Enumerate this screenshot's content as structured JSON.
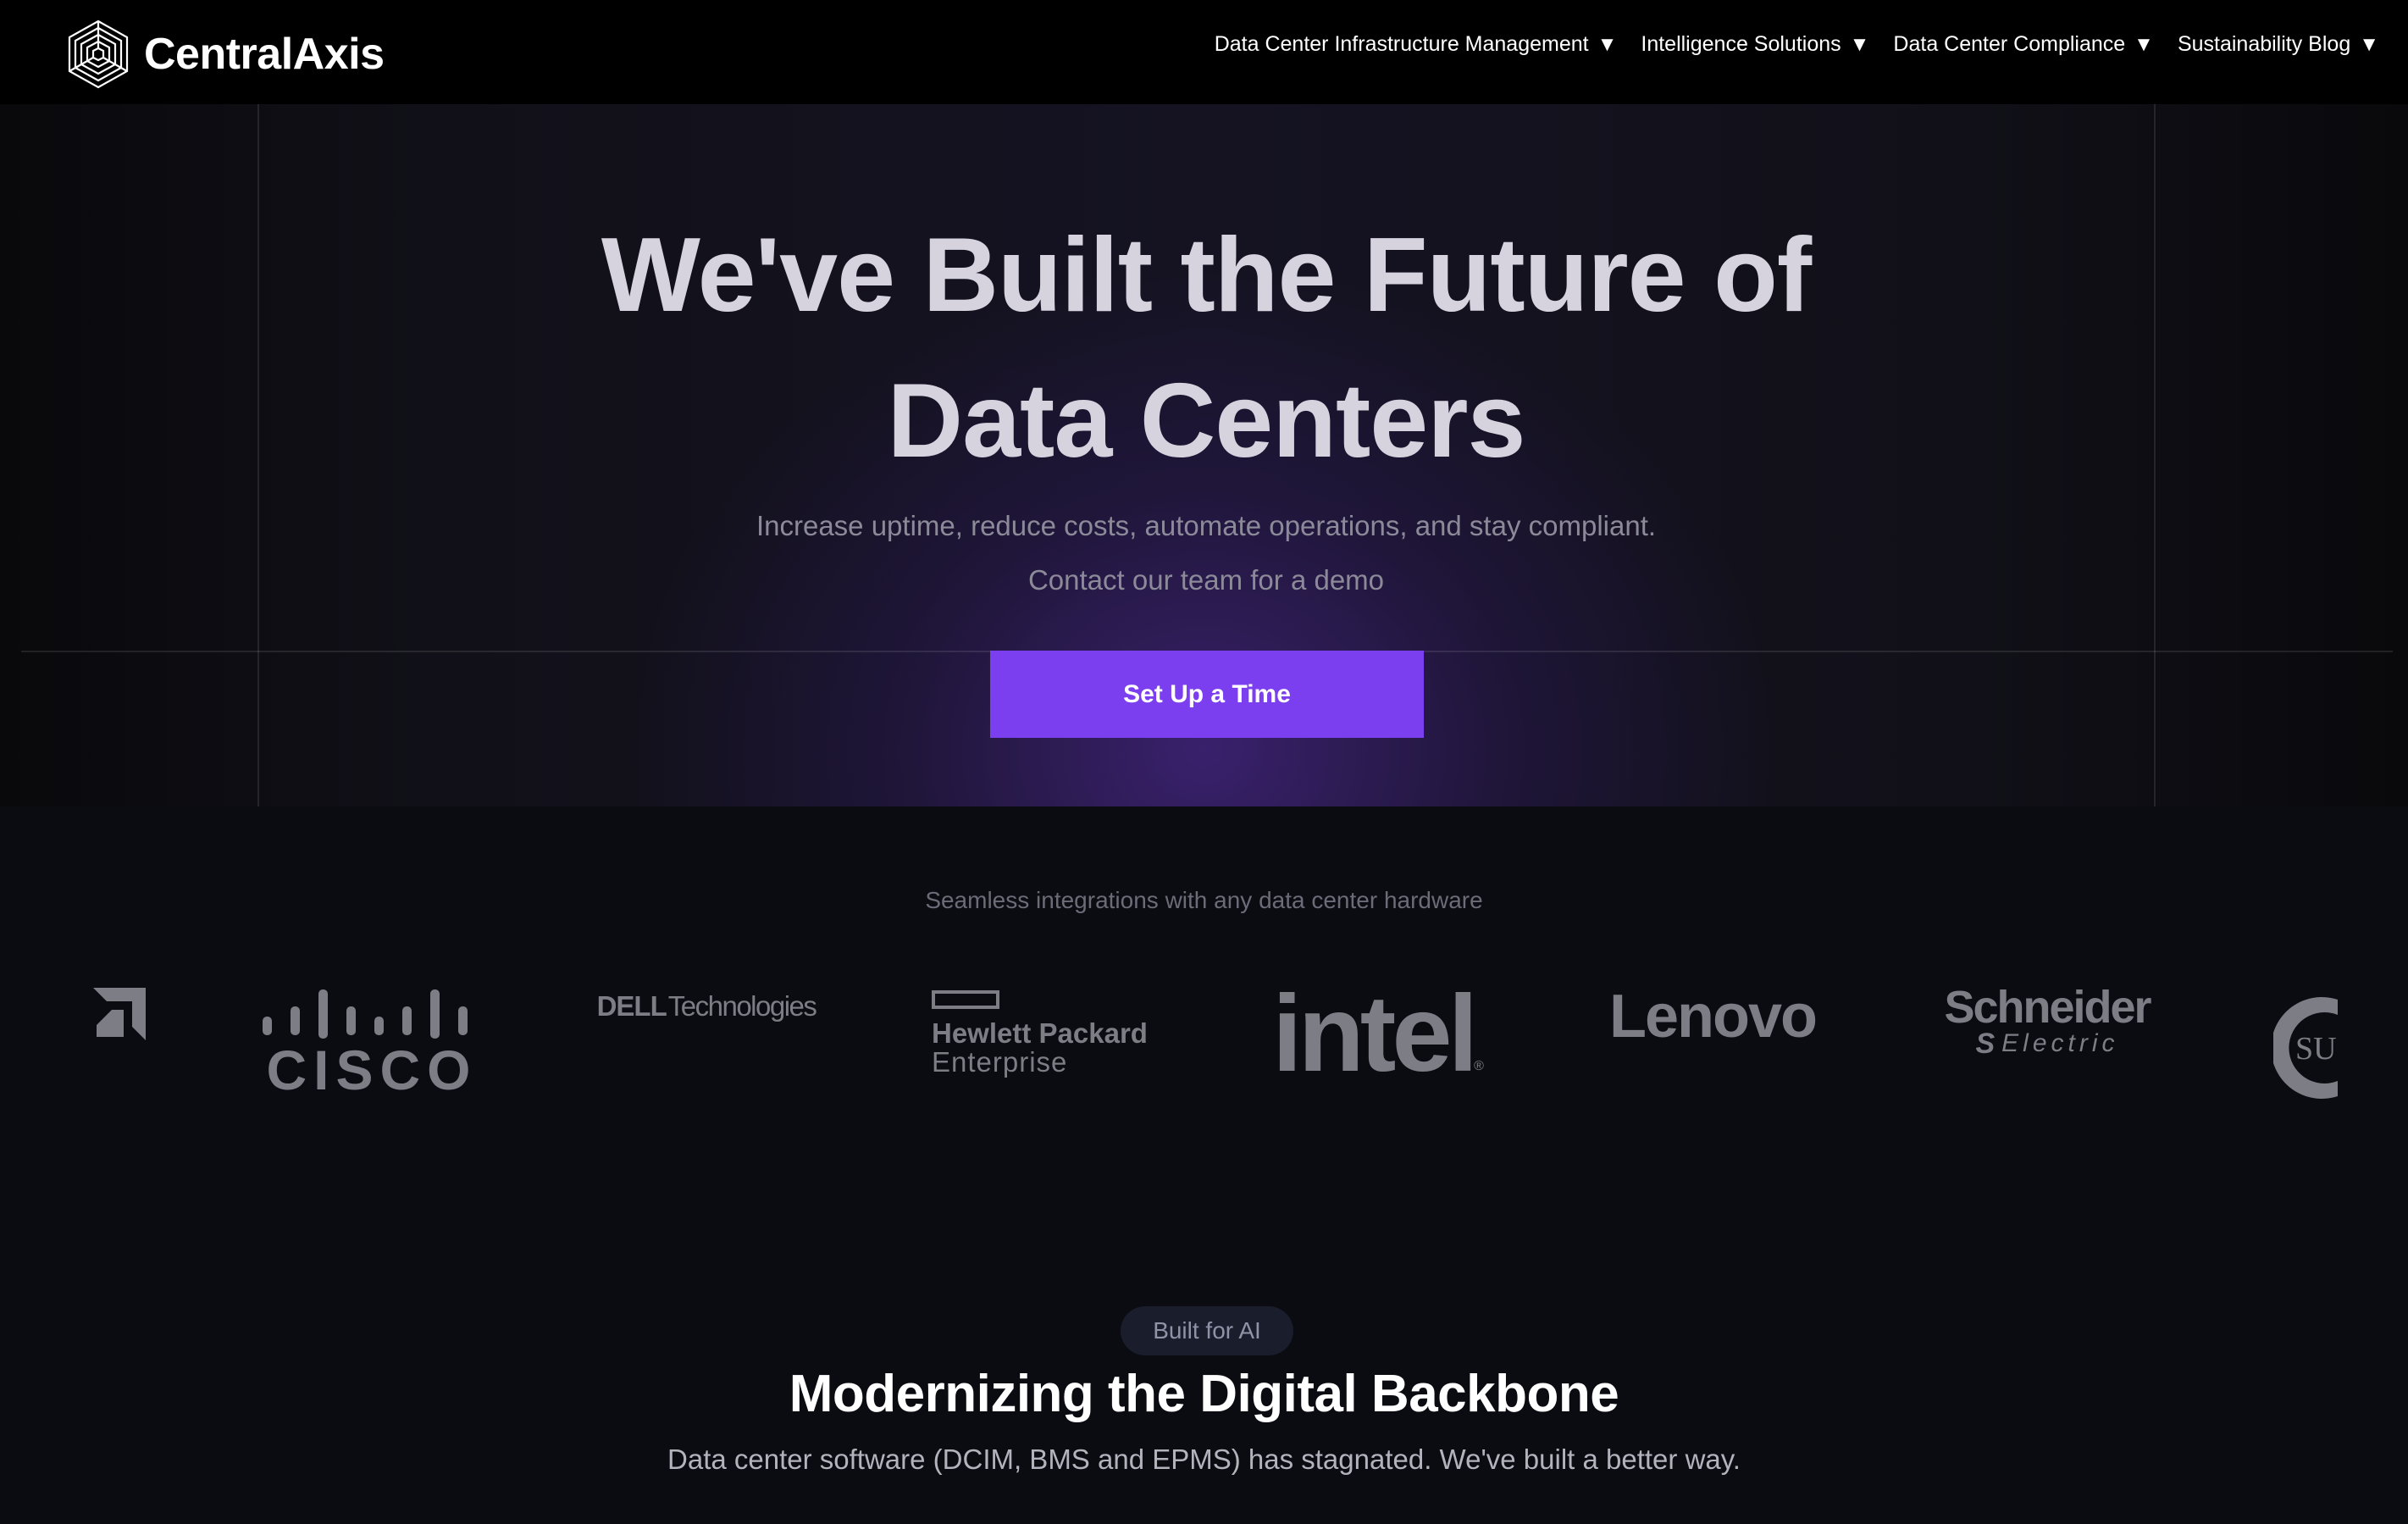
{
  "nav": {
    "brand": "CentralAxis",
    "menu": [
      {
        "label": "Data Center Infrastructure Management",
        "caret": "▼"
      },
      {
        "label": "Intelligence Solutions",
        "caret": "▼"
      },
      {
        "label": "Data Center Compliance",
        "caret": "▼"
      },
      {
        "label": "Sustainability Blog",
        "caret": "▼"
      }
    ]
  },
  "hero": {
    "title_line1": "We've Built the Future of",
    "title_line2": "Data Centers",
    "subtitle_line1": "Increase uptime, reduce costs, automate operations, and stay compliant.",
    "subtitle_line2": "Contact our team for a demo",
    "cta_label": "Set Up a Time"
  },
  "integrations": {
    "caption": "Seamless integrations with any data center hardware",
    "logos": {
      "cisco": "CISCO",
      "dell_a": "DELL",
      "dell_b": "Technologies",
      "hpe_a": "Hewlett Packard",
      "hpe_b": "Enterprise",
      "intel": "intel",
      "lenovo": "Lenovo",
      "schneider_a": "Schneider",
      "schneider_b": "Electric",
      "sun": "SU"
    }
  },
  "section": {
    "badge": "Built for AI",
    "title": "Modernizing the Digital Backbone",
    "subtitle": "Data center software (DCIM, BMS and EPMS) has stagnated. We've built a better way."
  },
  "colors": {
    "accent": "#7c3ff0",
    "nav_bg": "#000000",
    "logo_gray": "#7d7d86"
  }
}
